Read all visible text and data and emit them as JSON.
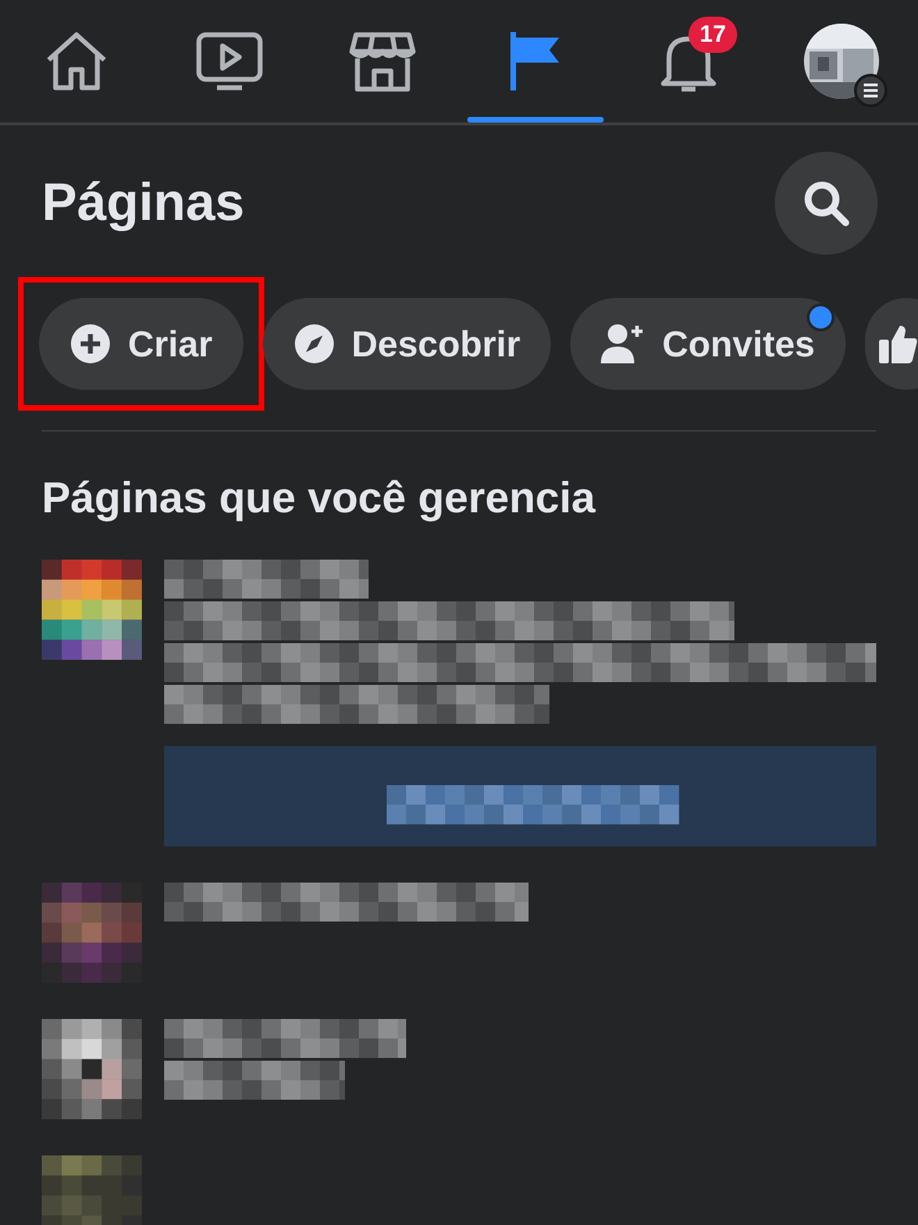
{
  "nav_tabs": [
    {
      "kind": "home",
      "selected": false
    },
    {
      "kind": "video",
      "selected": false
    },
    {
      "kind": "marketplace",
      "selected": false
    },
    {
      "kind": "pages",
      "selected": true
    },
    {
      "kind": "notifications",
      "selected": false,
      "badge": "17"
    },
    {
      "kind": "profile",
      "selected": false
    }
  ],
  "title": "Páginas",
  "filters": [
    {
      "kind": "create",
      "label": "Criar",
      "annotated": true,
      "notification_dot": false
    },
    {
      "kind": "discover",
      "label": "Descobrir",
      "annotated": false,
      "notification_dot": false
    },
    {
      "kind": "invites",
      "label": "Convites",
      "annotated": false,
      "notification_dot": true
    },
    {
      "kind": "like",
      "annotated": false,
      "notification_dot": false
    }
  ],
  "section_title": "Páginas que você gerencia",
  "managed_pages": [
    {
      "has_button": true
    },
    {
      "has_button": false
    },
    {
      "has_button": false
    },
    {
      "has_button": false
    }
  ]
}
